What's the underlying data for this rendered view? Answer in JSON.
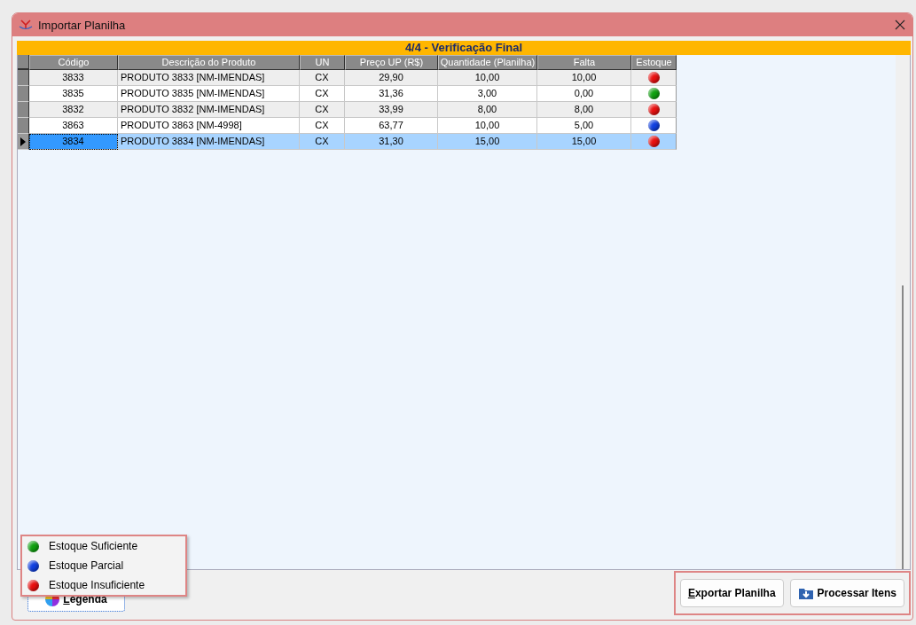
{
  "window": {
    "title": "Importar Planilha"
  },
  "step_title": "4/4 - Verificação Final",
  "table": {
    "columns": [
      "Código",
      "Descrição do Produto",
      "UN",
      "Preço UP (R$)",
      "Quantidade (Planilha)",
      "Falta",
      "Estoque"
    ],
    "rows": [
      {
        "selected": false,
        "cells": [
          "3833",
          "PRODUTO 3833 [NM-IMENDAS]",
          "CX",
          "29,90",
          "10,00",
          "10,00"
        ],
        "color": "#e81010"
      },
      {
        "selected": false,
        "cells": [
          "3835",
          "PRODUTO 3835 [NM-IMENDAS]",
          "CX",
          "31,36",
          "3,00",
          "0,00"
        ],
        "color": "#10a010"
      },
      {
        "selected": false,
        "cells": [
          "3832",
          "PRODUTO 3832 [NM-IMENDAS]",
          "CX",
          "33,99",
          "8,00",
          "8,00"
        ],
        "color": "#e81010"
      },
      {
        "selected": false,
        "cells": [
          "3863",
          "PRODUTO 3863 [NM-4998]",
          "CX",
          "63,77",
          "10,00",
          "5,00"
        ],
        "color": "#1040e0"
      },
      {
        "selected": true,
        "cells": [
          "3834",
          "PRODUTO 3834 [NM-IMENDAS]",
          "CX",
          "31,30",
          "15,00",
          "15,00"
        ],
        "color": "#e81010"
      }
    ]
  },
  "legend": [
    {
      "label": "Estoque Suficiente",
      "color": "#10a010"
    },
    {
      "label": "Estoque Parcial",
      "color": "#1040e0"
    },
    {
      "label": "Estoque Insuficiente",
      "color": "#e81010"
    }
  ],
  "buttons": {
    "legend": "Legenda",
    "export": "Exportar Planilha",
    "process": "Processar Itens"
  }
}
